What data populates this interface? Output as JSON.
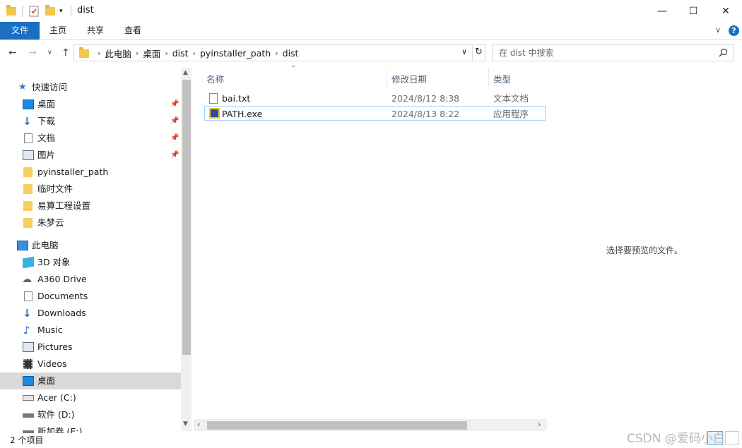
{
  "window": {
    "title": "dist",
    "minimize_glyph": "—",
    "maximize_glyph": "☐",
    "close_glyph": "✕"
  },
  "ribbon": {
    "tabs": [
      "文件",
      "主页",
      "共享",
      "查看"
    ],
    "help_glyph": "?",
    "expand_glyph": "∨",
    "accent": "#1a6fc2"
  },
  "address": {
    "crumbs": [
      "此电脑",
      "桌面",
      "dist",
      "pyinstaller_path",
      "dist"
    ],
    "search_placeholder": "在 dist 中搜索"
  },
  "navigation": {
    "quick_access_label": "快速访问",
    "quick_items": [
      {
        "label": "桌面",
        "icon": "desktop-icon",
        "pinned": true
      },
      {
        "label": "下载",
        "icon": "download-icon",
        "pinned": true
      },
      {
        "label": "文档",
        "icon": "document-icon",
        "pinned": true
      },
      {
        "label": "图片",
        "icon": "picture-icon",
        "pinned": true
      },
      {
        "label": "pyinstaller_path",
        "icon": "folder-icon",
        "pinned": false
      },
      {
        "label": "临时文件",
        "icon": "folder-icon",
        "pinned": false
      },
      {
        "label": "易算工程设置",
        "icon": "folder-icon",
        "pinned": false
      },
      {
        "label": "朱梦云",
        "icon": "folder-icon",
        "pinned": false
      }
    ],
    "this_pc_label": "此电脑",
    "pc_items": [
      {
        "label": "3D 对象",
        "icon": "cube-icon"
      },
      {
        "label": "A360 Drive",
        "icon": "cloud-drive-icon"
      },
      {
        "label": "Documents",
        "icon": "document-icon"
      },
      {
        "label": "Downloads",
        "icon": "download-icon"
      },
      {
        "label": "Music",
        "icon": "music-icon"
      },
      {
        "label": "Pictures",
        "icon": "picture-icon"
      },
      {
        "label": "Videos",
        "icon": "video-icon"
      },
      {
        "label": "桌面",
        "icon": "desktop-icon"
      },
      {
        "label": "Acer (C:)",
        "icon": "drive-icon"
      },
      {
        "label": "软件 (D:)",
        "icon": "drive-icon"
      },
      {
        "label": "新加卷 (E:)",
        "icon": "drive-icon"
      }
    ]
  },
  "filelist": {
    "columns": [
      "名称",
      "修改日期",
      "类型"
    ],
    "rows": [
      {
        "name": "bai.txt",
        "date": "2024/8/12 8:38",
        "type": "文本文档",
        "icon": "text-file-icon"
      },
      {
        "name": "PATH.exe",
        "date": "2024/8/13 8:22",
        "type": "应用程序",
        "icon": "exe-file-icon"
      }
    ]
  },
  "preview": {
    "message": "选择要预览的文件。"
  },
  "status": {
    "text": "2 个项目"
  },
  "watermark": "CSDN @爱码小白"
}
